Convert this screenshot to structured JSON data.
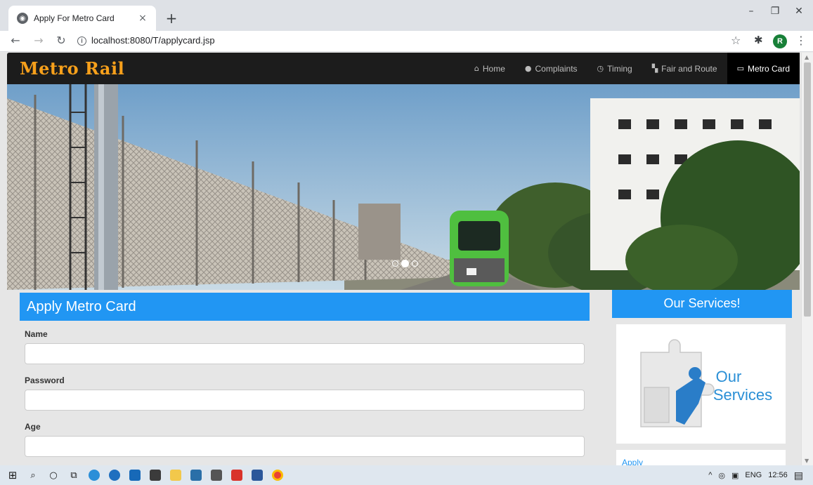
{
  "browser": {
    "tab_title": "Apply For Metro Card",
    "tab_close": "×",
    "new_tab": "+",
    "url": "localhost:8080/T/applycard.jsp",
    "profile_initial": "R",
    "icons": {
      "back": "←",
      "forward": "→",
      "reload": "↻",
      "info": "i",
      "star": "☆",
      "extensions": "✱",
      "menu": "⋮",
      "minimize": "–",
      "maximize": "❐",
      "close": "✕"
    }
  },
  "site": {
    "brand": "Metro Rail",
    "nav": [
      {
        "label": "Home",
        "icon": "⌂"
      },
      {
        "label": "Complaints",
        "icon": "●"
      },
      {
        "label": "Timing",
        "icon": "◷"
      },
      {
        "label": "Fair and Route",
        "icon": "▚"
      },
      {
        "label": "Metro Card",
        "icon": "▭"
      }
    ],
    "active_nav": "Metro Card",
    "carousel": {
      "slides": 3,
      "active": 2
    }
  },
  "form": {
    "title": "Apply Metro Card",
    "fields": [
      {
        "label": "Name",
        "value": "",
        "placeholder": ""
      },
      {
        "label": "Password",
        "value": "",
        "placeholder": ""
      },
      {
        "label": "Age",
        "value": "",
        "placeholder": ""
      }
    ]
  },
  "sidebar": {
    "title": "Our Services!",
    "image_text_1": "Our",
    "image_text_2": "Services",
    "links": [
      "Apply"
    ]
  },
  "taskbar": {
    "lang": "ENG",
    "time": "12:56",
    "icons": {
      "start": "⊞",
      "search": "⌕",
      "cortana": "○",
      "taskview": "⧉",
      "tray_up": "^",
      "notify": "▤"
    }
  },
  "colors": {
    "accent": "#2196f3",
    "brand": "#f7a01b",
    "navbar": "#1c1c1c",
    "active_nav": "#000000",
    "train_green": "#4fbf3f"
  }
}
